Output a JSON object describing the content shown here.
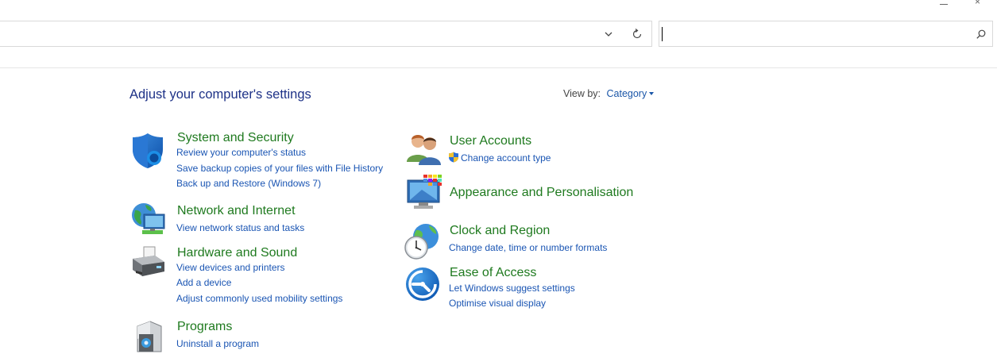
{
  "window": {
    "minimize_glyph": "–",
    "close_glyph": "×"
  },
  "address": {
    "text": "",
    "search_value": "",
    "search_placeholder": ""
  },
  "header": {
    "title": "Adjust your computer's settings",
    "view_by_label": "View by:",
    "view_by_value": "Category"
  },
  "categories": [
    {
      "title": "System and Security",
      "icon": "shield-icon",
      "links": [
        "Review your computer's status",
        "Save backup copies of your files with File History",
        "Back up and Restore (Windows 7)"
      ]
    },
    {
      "title": "Network and Internet",
      "icon": "network-globe-icon",
      "links": [
        "View network status and tasks"
      ]
    },
    {
      "title": "Hardware and Sound",
      "icon": "printer-icon",
      "links": [
        "View devices and printers",
        "Add a device",
        "Adjust commonly used mobility settings"
      ]
    },
    {
      "title": "Programs",
      "icon": "programs-box-icon",
      "links": [
        "Uninstall a program"
      ]
    },
    {
      "title": "User Accounts",
      "icon": "users-icon",
      "links": [
        "Change account type"
      ]
    },
    {
      "title": "Appearance and Personalisation",
      "icon": "monitor-palette-icon",
      "links": []
    },
    {
      "title": "Clock and Region",
      "icon": "clock-globe-icon",
      "links": [
        "Change date, time or number formats"
      ]
    },
    {
      "title": "Ease of Access",
      "icon": "ease-of-access-icon",
      "links": [
        "Let Windows suggest settings",
        "Optimise visual display"
      ]
    }
  ]
}
